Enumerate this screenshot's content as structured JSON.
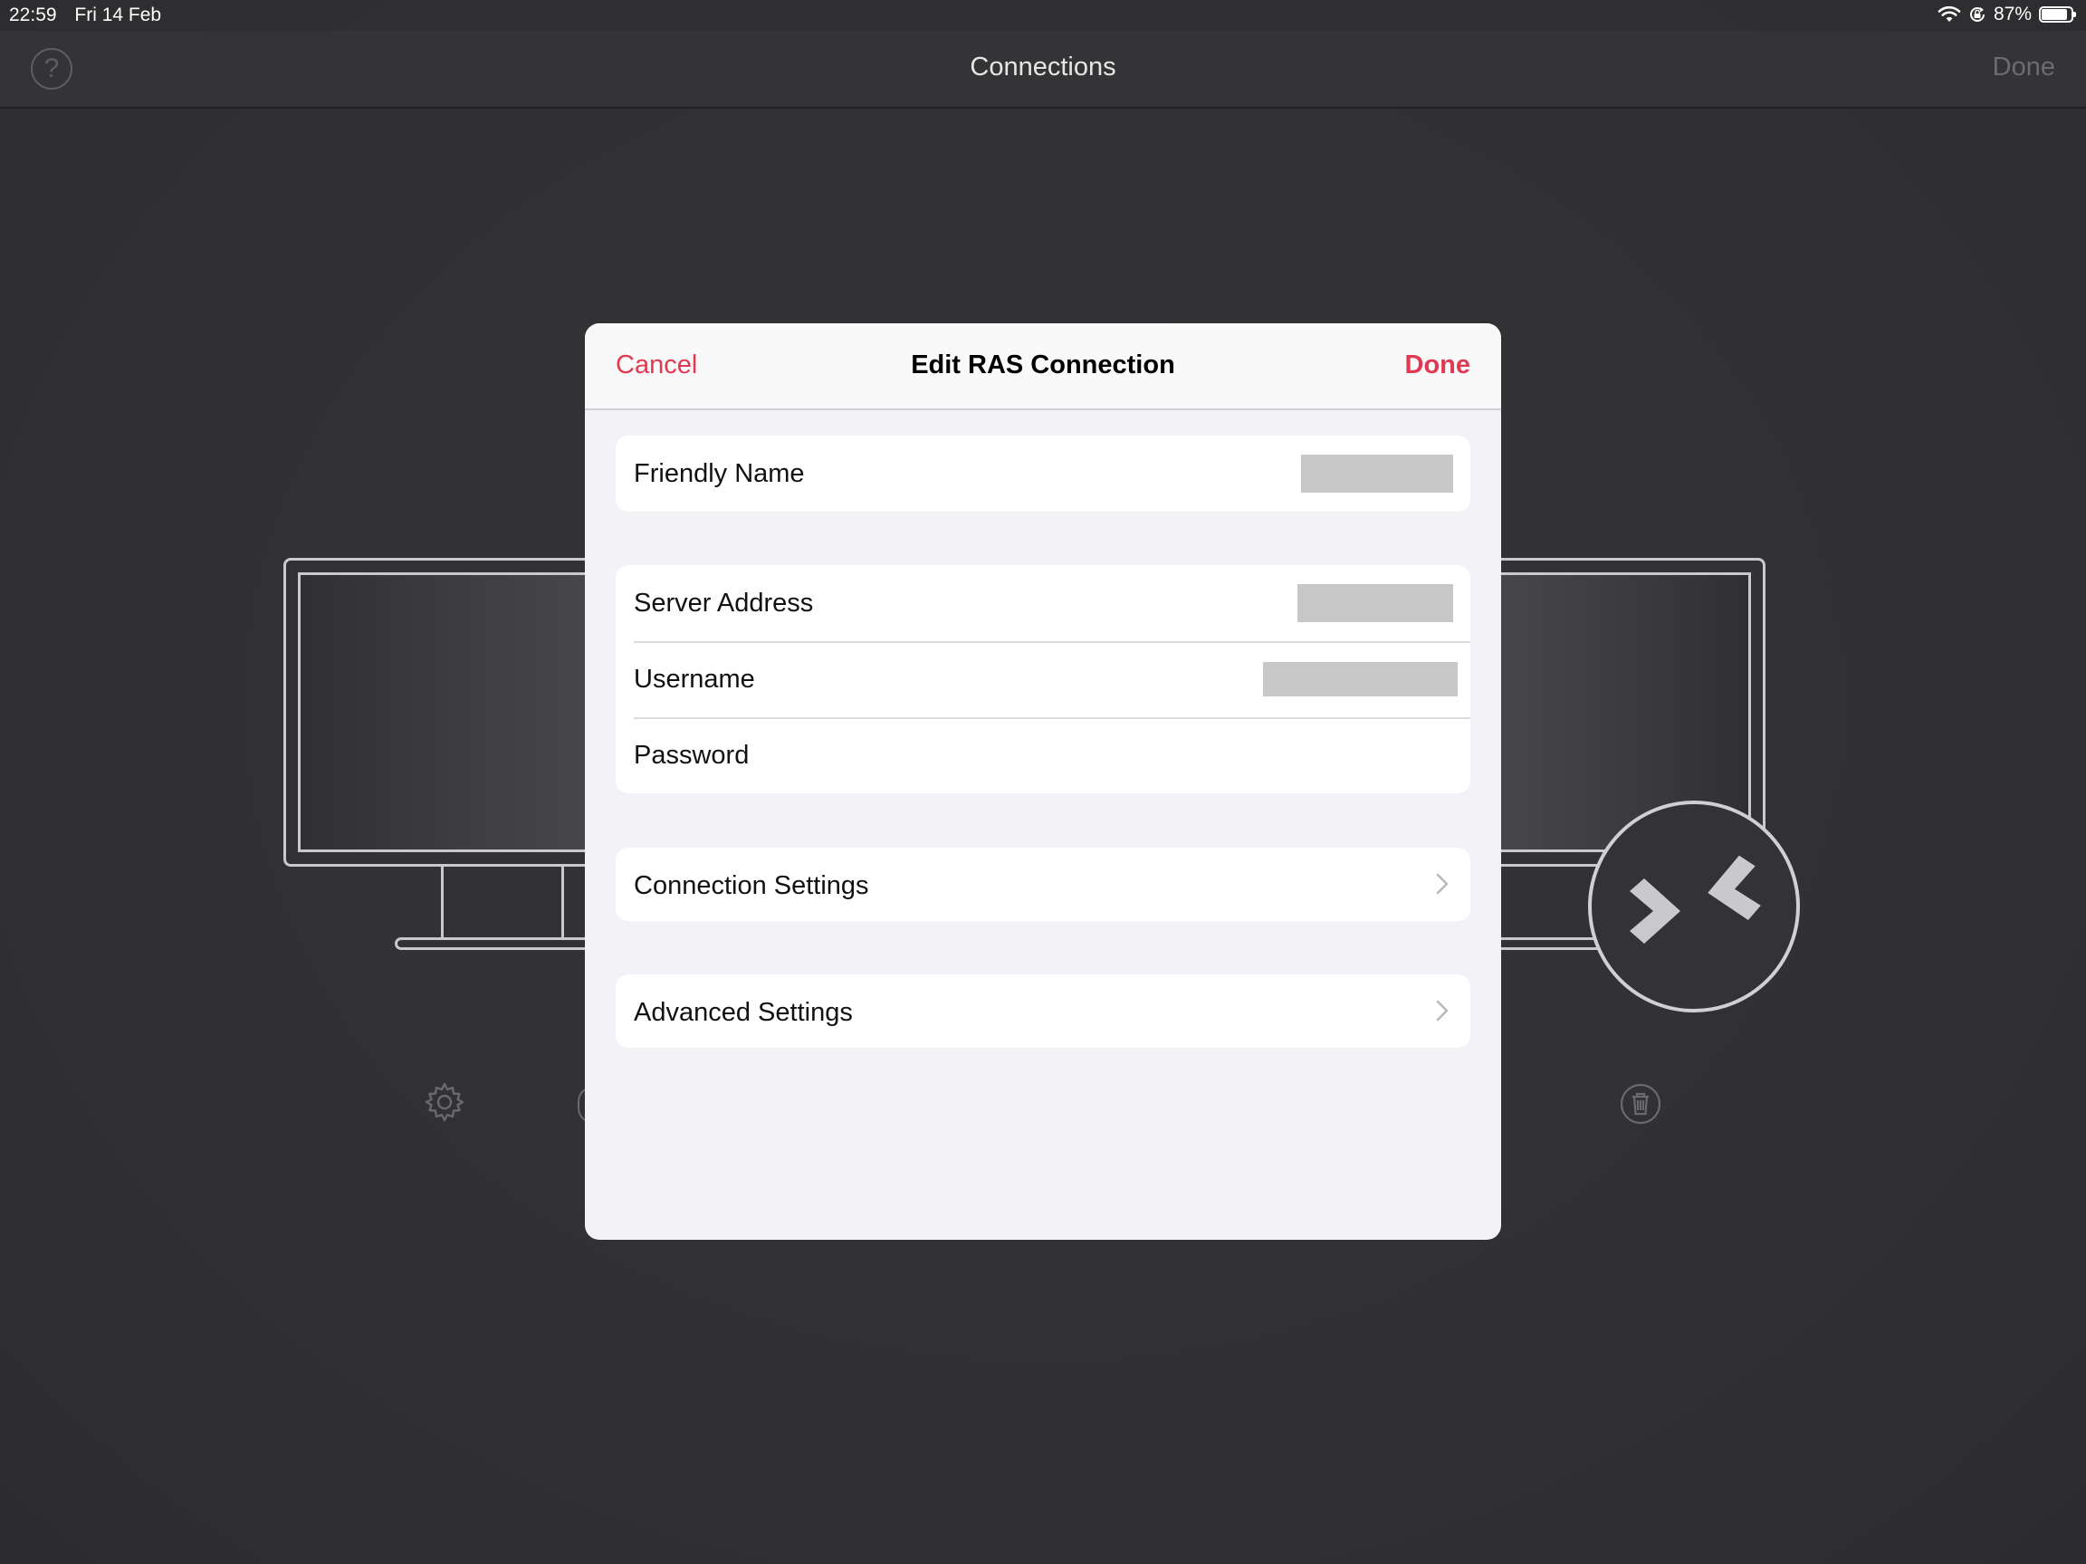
{
  "status_bar": {
    "time": "22:59",
    "date": "Fri 14 Feb",
    "battery_percent": "87%",
    "battery_level": 0.87,
    "icons": [
      "wifi-icon",
      "orientation-lock-icon",
      "battery-icon"
    ]
  },
  "nav": {
    "title": "Connections",
    "help_glyph": "?",
    "done_label": "Done"
  },
  "background": {
    "icons": [
      "gear-icon",
      "trash-icon",
      "remote-desktop-logo-icon"
    ]
  },
  "modal": {
    "cancel_label": "Cancel",
    "title": "Edit RAS Connection",
    "done_label": "Done",
    "accent_color": "#e03a52",
    "groups": {
      "name": {
        "friendly_name_label": "Friendly Name"
      },
      "credentials": {
        "server_address_label": "Server Address",
        "username_label": "Username",
        "password_label": "Password"
      },
      "connection_settings_label": "Connection Settings",
      "advanced_settings_label": "Advanced Settings"
    }
  }
}
